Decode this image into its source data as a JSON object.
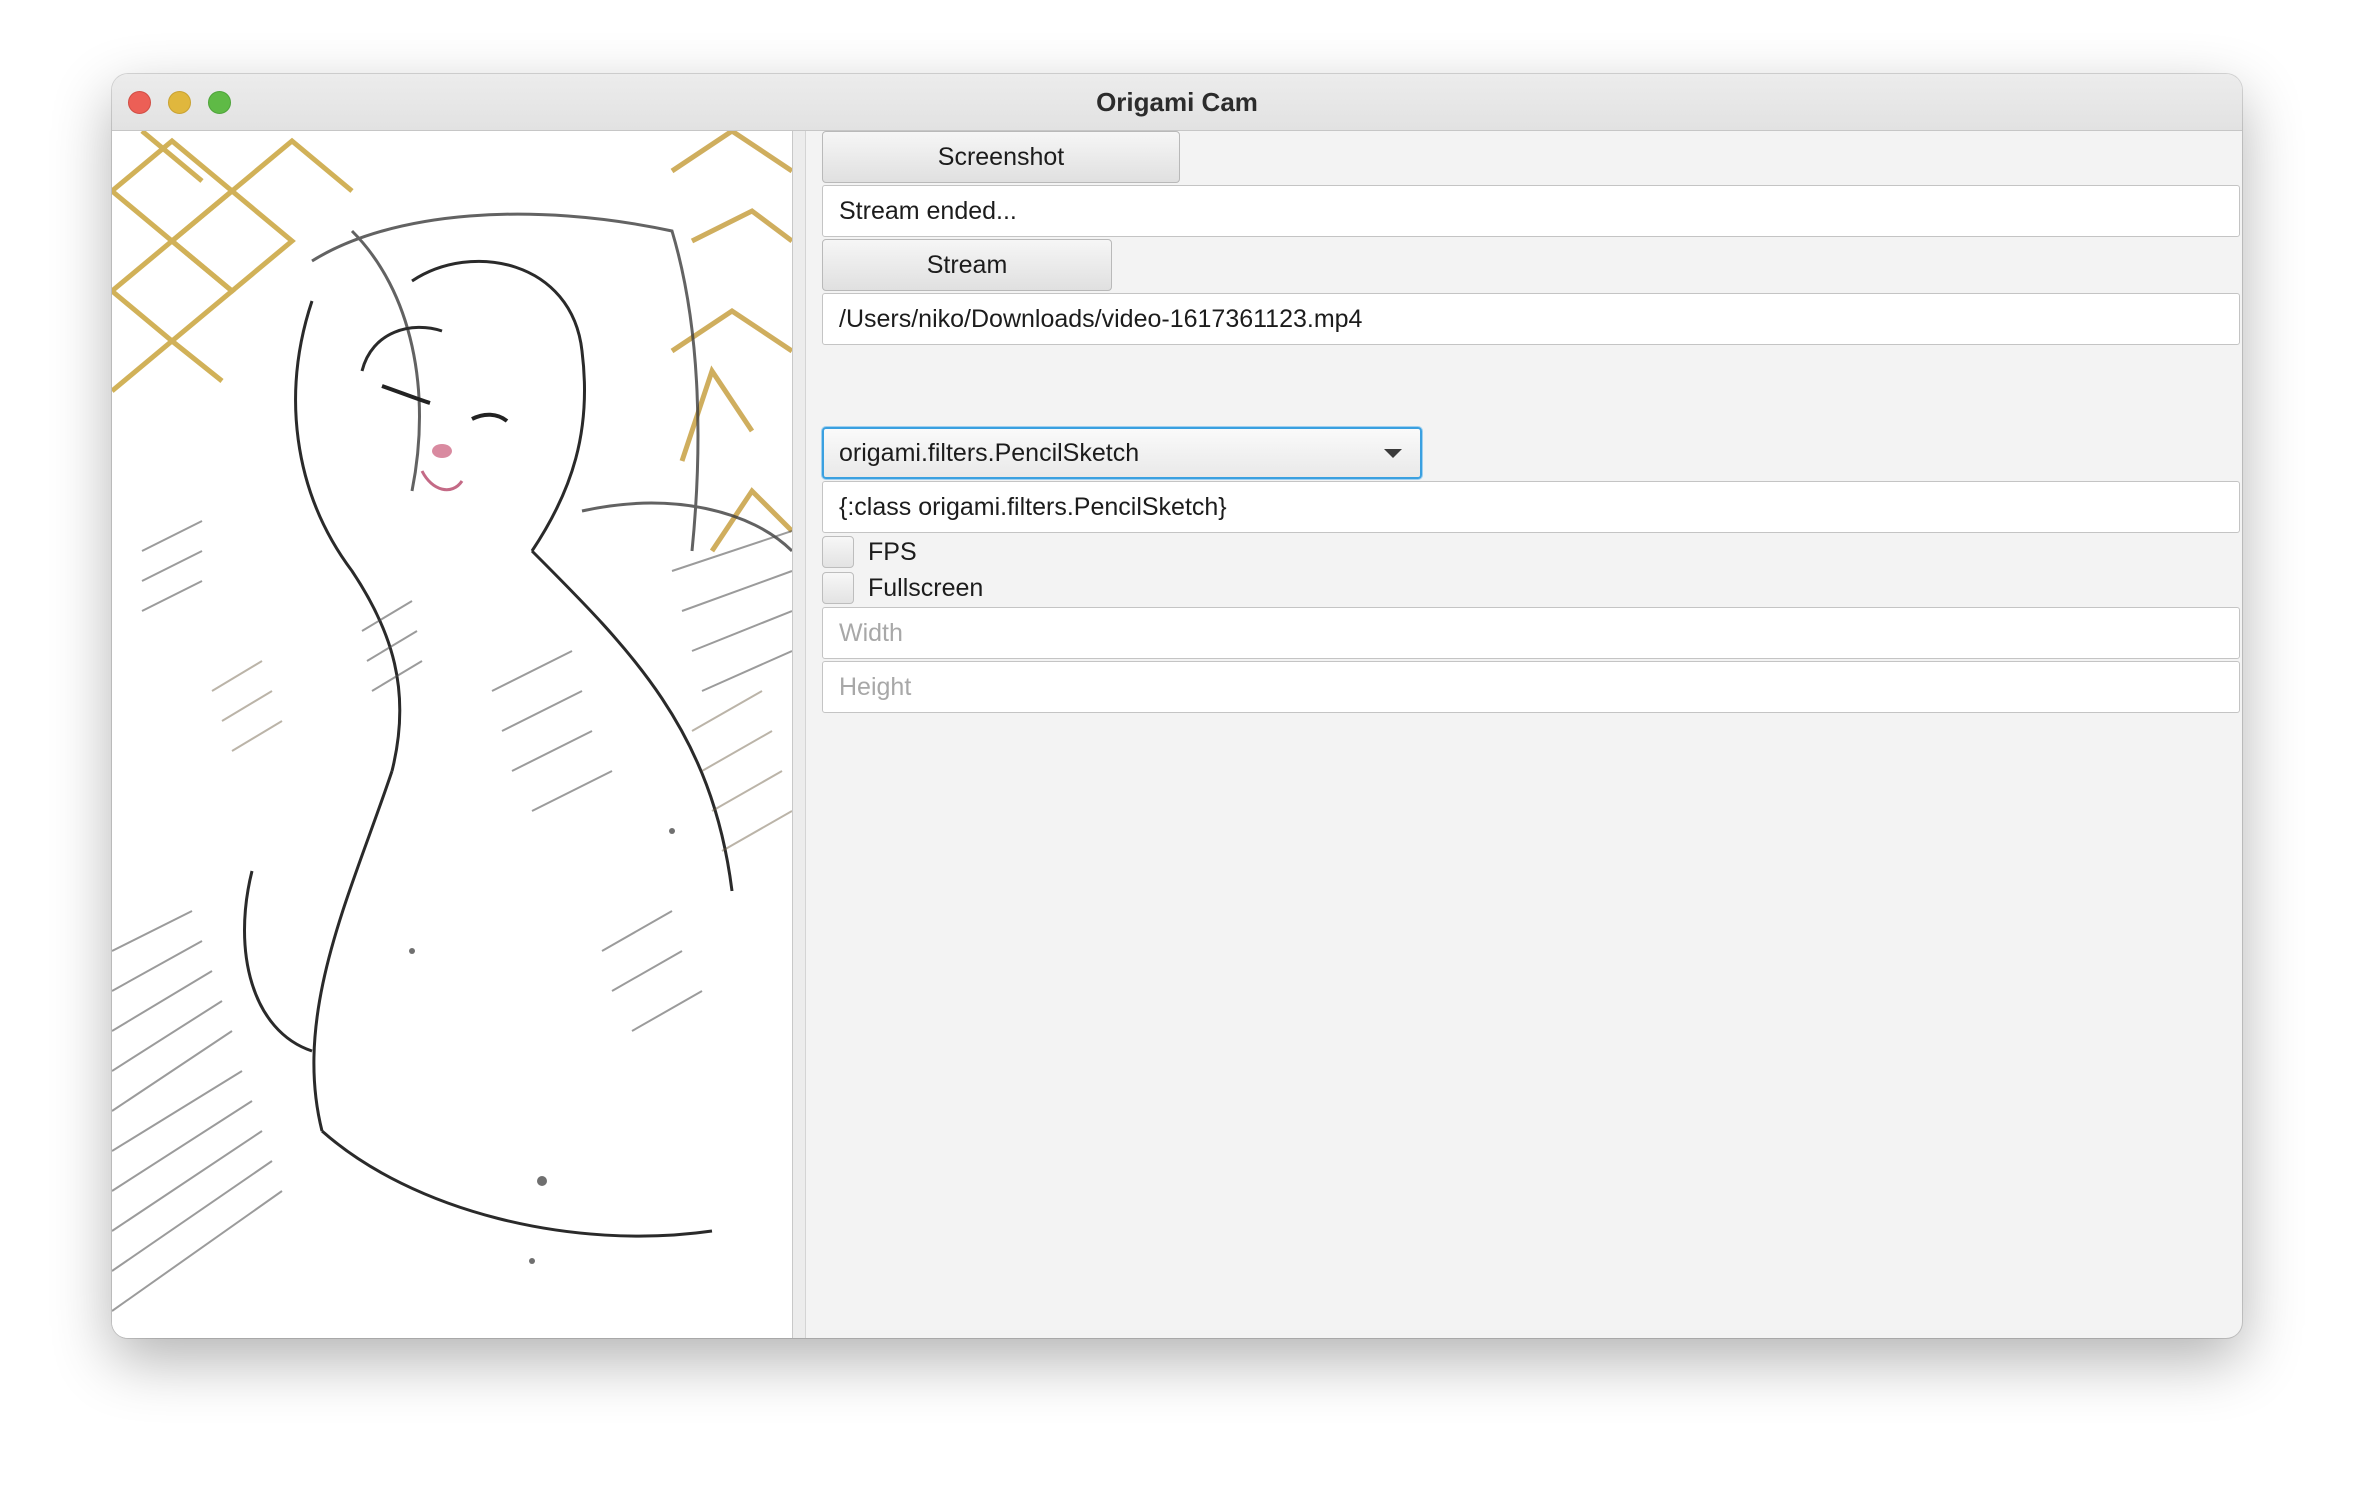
{
  "window": {
    "title": "Origami Cam"
  },
  "preview": {
    "description_icon": "pencil-sketch-cat-image"
  },
  "controls": {
    "screenshot_label": "Screenshot",
    "status_text": "Stream ended...",
    "stream_label": "Stream",
    "source_path": "/Users/niko/Downloads/video-1617361123.mp4",
    "filter_selected": "origami.filters.PencilSketch",
    "filter_config": "{:class origami.filters.PencilSketch}",
    "fps_label": "FPS",
    "fullscreen_label": "Fullscreen",
    "width_placeholder": "Width",
    "height_placeholder": "Height"
  },
  "colors": {
    "focus_accent": "#3aa0e0",
    "close": "#ec5f56",
    "minimize": "#e0b73d",
    "zoom": "#5fba46"
  }
}
